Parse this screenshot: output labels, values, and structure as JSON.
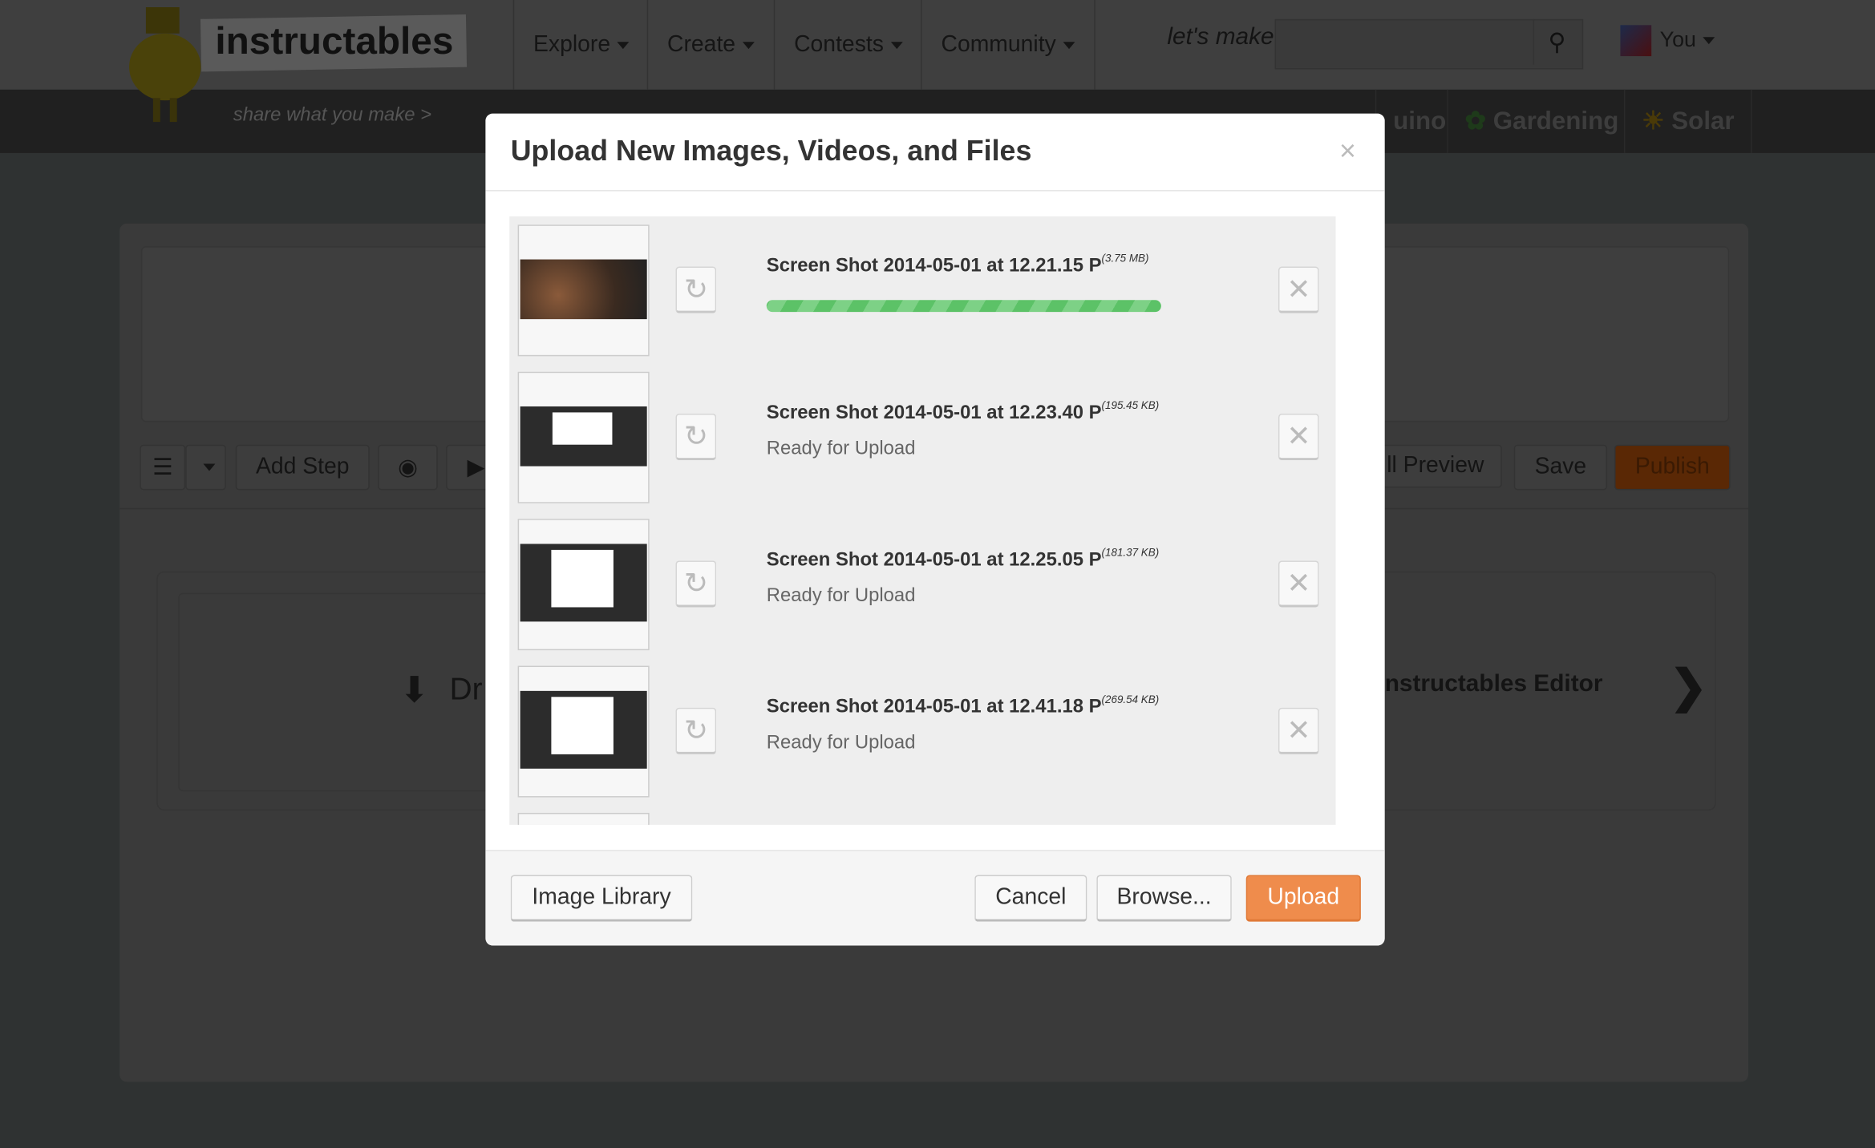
{
  "header": {
    "logo": "instructables",
    "tagline": "share what you make >",
    "menu": [
      {
        "label": "Explore"
      },
      {
        "label": "Create"
      },
      {
        "label": "Contests"
      },
      {
        "label": "Community"
      }
    ],
    "lets_make": "let's make",
    "search_placeholder": "",
    "user": "You"
  },
  "channels": [
    {
      "label": "uino"
    },
    {
      "label": "Gardening"
    },
    {
      "label": "Solar"
    }
  ],
  "editor": {
    "add_step": "Add Step",
    "preview": "ll Preview",
    "save": "Save",
    "publish": "Publish",
    "drop_text": "Dr",
    "editor_text": "nstructables Editor"
  },
  "modal": {
    "title": "Upload New Images, Videos, and Files",
    "close": "×",
    "files": [
      {
        "name": "Screen Shot 2014-05-01 at 12.21.15 P",
        "size": "(3.75 MB)",
        "status": "",
        "progress": 100
      },
      {
        "name": "Screen Shot 2014-05-01 at 12.23.40 P",
        "size": "(195.45 KB)",
        "status": "Ready for Upload"
      },
      {
        "name": "Screen Shot 2014-05-01 at 12.25.05 P",
        "size": "(181.37 KB)",
        "status": "Ready for Upload"
      },
      {
        "name": "Screen Shot 2014-05-01 at 12.41.18 P",
        "size": "(269.54 KB)",
        "status": "Ready for Upload"
      }
    ],
    "footer": {
      "image_library": "Image Library",
      "cancel": "Cancel",
      "browse": "Browse...",
      "upload": "Upload"
    }
  },
  "colors": {
    "accent": "#ef8c4c",
    "progress": "#5cc267"
  }
}
